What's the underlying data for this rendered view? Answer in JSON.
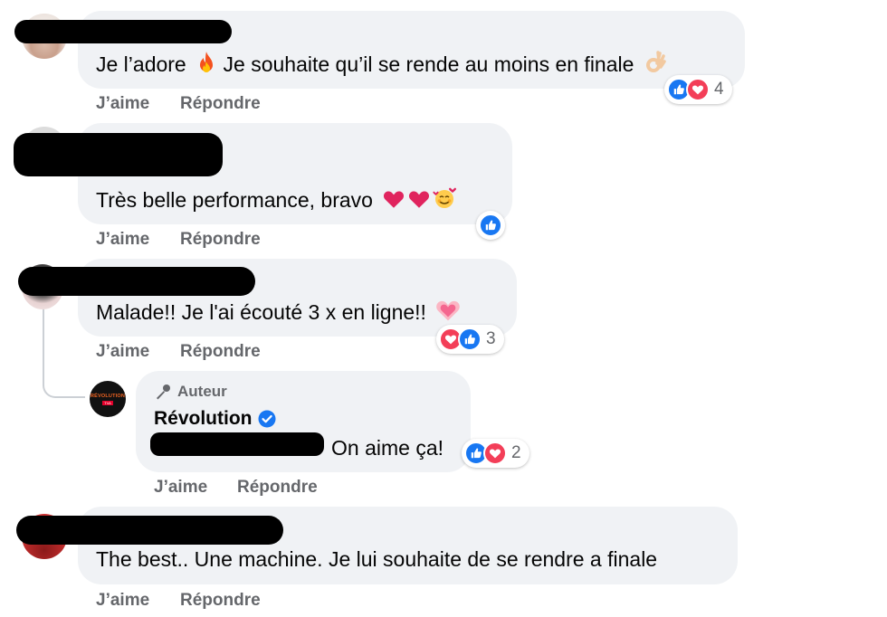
{
  "colors": {
    "like": "#1877f2",
    "love": "#f33e58",
    "verified": "#1877f2",
    "bubble": "#f0f2f5",
    "meta": "#65676b"
  },
  "actions": {
    "like": "J’aime",
    "reply": "Répondre"
  },
  "comments": [
    {
      "text": "Je l’adore",
      "text2": "Je souhaite qu’il se rende au moins en finale",
      "reactions": "4"
    },
    {
      "text": "Très belle performance, bravo"
    },
    {
      "text": "Malade!! Je l'ai écouté 3 x en ligne!!",
      "reactions": "3"
    },
    {
      "text": "The best.. Une machine. Je lui souhaite de se rendre a finale"
    }
  ],
  "reply": {
    "badge": "Auteur",
    "author": "Révolution",
    "text": "On aime ça!",
    "reactions": "2",
    "avatar_label": "RÉVOLUTION",
    "avatar_sub": "TVA"
  }
}
